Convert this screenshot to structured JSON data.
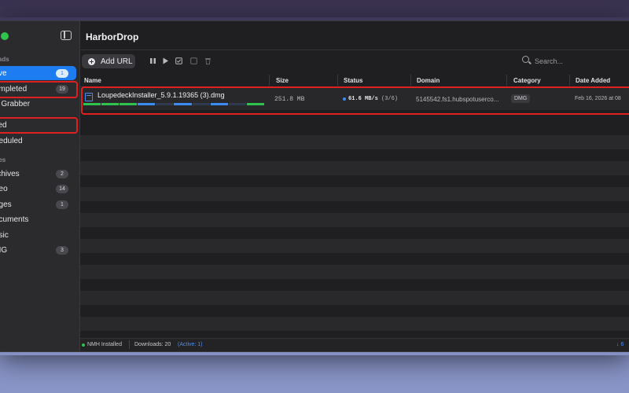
{
  "window": {
    "title": "HarborDrop"
  },
  "sidebar": {
    "sections": [
      {
        "label": "oads"
      },
      {
        "label": "ries"
      }
    ],
    "items": [
      {
        "label": "tive",
        "badge": "1",
        "active": true,
        "highlighted": false
      },
      {
        "label": "ompleted",
        "badge": "19",
        "active": false,
        "highlighted": true
      },
      {
        "label": "e Grabber",
        "badge": "",
        "active": false,
        "highlighted": false
      },
      {
        "label": "iled",
        "badge": "",
        "active": false,
        "highlighted": true
      },
      {
        "label": "heduled",
        "badge": "",
        "active": false,
        "highlighted": false
      },
      {
        "label": "rchives",
        "badge": "2",
        "active": false,
        "highlighted": false
      },
      {
        "label": "deo",
        "badge": "14",
        "active": false,
        "highlighted": false
      },
      {
        "label": "ages",
        "badge": "1",
        "active": false,
        "highlighted": false
      },
      {
        "label": "ocuments",
        "badge": "",
        "active": false,
        "highlighted": false
      },
      {
        "label": "usic",
        "badge": "",
        "active": false,
        "highlighted": false
      },
      {
        "label": "MG",
        "badge": "3",
        "active": false,
        "highlighted": false
      },
      {
        "label": "",
        "badge": "",
        "active": false,
        "highlighted": false
      }
    ]
  },
  "toolbar": {
    "add_label": "Add URL",
    "icons": [
      "pause-icon",
      "play-icon",
      "checkbox-checked-icon",
      "checkbox-empty-icon",
      "trash-icon"
    ],
    "search_placeholder": "Search..."
  },
  "table": {
    "columns": [
      "Name",
      "Size",
      "Status",
      "Domain",
      "Category",
      "Date Added"
    ],
    "rows": [
      {
        "name": "LoupedeckInstaller_5.9.1.19365 (3).dmg",
        "size": "251.8 MB",
        "speed": "61.6 MB/s",
        "segments": "(3/6)",
        "domain": "5145542.fs1.hubspotuserco...",
        "category": "DMG",
        "date_added": "Feb 16, 2026 at 08"
      }
    ]
  },
  "progress_segments": [
    "complete",
    "complete",
    "complete",
    "active",
    "pending",
    "active",
    "pending",
    "active",
    "pending",
    "complete"
  ],
  "statusbar": {
    "nmh": "NMH Installed",
    "downloads": "Downloads: 20",
    "active": "(Active: 1)",
    "right": "↓ 6"
  },
  "colors": {
    "accent": "#1d7cf2",
    "highlight": "#e02020",
    "progress_complete": "#2fc24c",
    "progress_active": "#3b8cf2",
    "progress_pending": "#2f3a4e"
  }
}
